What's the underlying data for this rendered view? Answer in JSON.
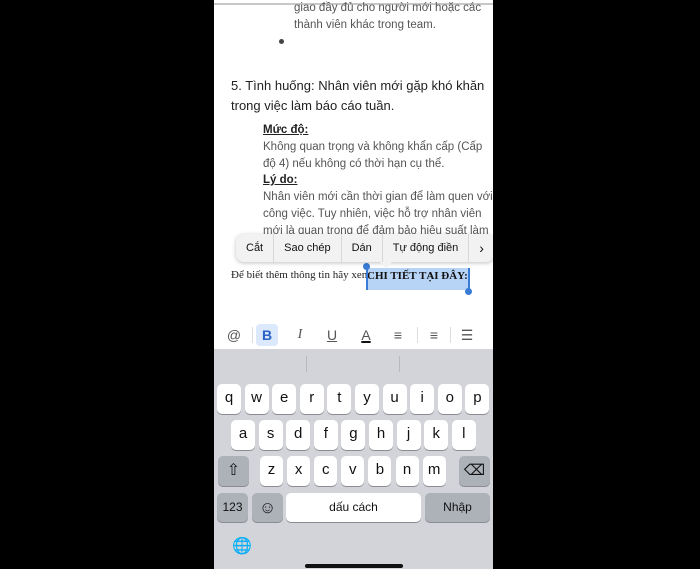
{
  "document": {
    "prev_line1": "giao đầy đủ cho người mới hoặc các",
    "prev_line2": "thành viên khác trong team.",
    "heading_line1": "5. Tình huống: Nhân viên mới gặp khó khăn",
    "heading_line2": "trong việc làm báo cáo tuần.",
    "muc_do_label": "Mức độ:",
    "muc_do_line1": "Không quan trọng và không khẩn cấp (Cấp",
    "muc_do_line2": "độ 4) nếu không có thời hạn cụ thể.",
    "ly_do_label": "Lý do:",
    "ly_do_line1": "Nhân viên mới cần thời gian để làm quen với",
    "ly_do_line2": "công việc. Tuy nhiên, việc hỗ trợ nhân viên",
    "ly_do_line3": "mới là quan trọng để đảm bảo hiệu suất làm",
    "link_prefix": "Để biết thêm thông tin hãy xem",
    "link_selected": "CHI TIẾT TẠI ĐÂY:"
  },
  "context_menu": {
    "cut": "Cắt",
    "copy": "Sao chép",
    "paste": "Dán",
    "autofill": "Tự động điền",
    "more": "›"
  },
  "format_bar": {
    "mention": "@",
    "bold": "B",
    "italic": "I",
    "underline": "U",
    "text_color": "A",
    "align_left": "≡",
    "align_center": "≡",
    "list": "☰"
  },
  "keyboard": {
    "row1": [
      "q",
      "w",
      "e",
      "r",
      "t",
      "y",
      "u",
      "i",
      "o",
      "p"
    ],
    "row2": [
      "a",
      "s",
      "d",
      "f",
      "g",
      "h",
      "j",
      "k",
      "l"
    ],
    "row3": [
      "z",
      "x",
      "c",
      "v",
      "b",
      "n",
      "m"
    ],
    "shift": "⇧",
    "backspace": "⌫",
    "numbers": "123",
    "emoji": "☺",
    "space": "dấu cách",
    "return": "Nhập",
    "globe": "🌐"
  },
  "colors": {
    "selection": "#b7d3f5",
    "accent": "#3a7bd5"
  }
}
